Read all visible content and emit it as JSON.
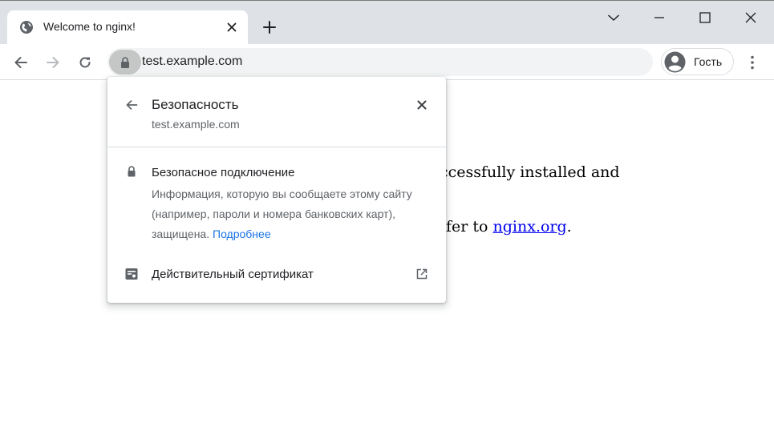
{
  "tab": {
    "title": "Welcome to nginx!",
    "favicon": "globe-icon"
  },
  "window_controls": [
    "chevron-down-icon",
    "minimize-icon",
    "maximize-icon",
    "close-icon"
  ],
  "toolbar": {
    "url": "test.example.com",
    "profile_label": "Гость"
  },
  "page": {
    "line1": "ccessfully installed and",
    "line2_prefix": "fer to ",
    "line2_link": "nginx.org",
    "line2_suffix": "."
  },
  "popup": {
    "title": "Безопасность",
    "subtitle": "test.example.com",
    "secure_title": "Безопасное подключение",
    "secure_desc": "Информация, которую вы сообщаете этому сайту (например, пароли и номера банковских карт), защищена.",
    "learn_more": "Подробнее",
    "certificate_label": "Действительный сертификат"
  },
  "colors": {
    "tabstrip": "#dee1e6",
    "omnibox": "#f1f3f4",
    "link": "#1a73e8",
    "page_link": "#0000ee"
  }
}
